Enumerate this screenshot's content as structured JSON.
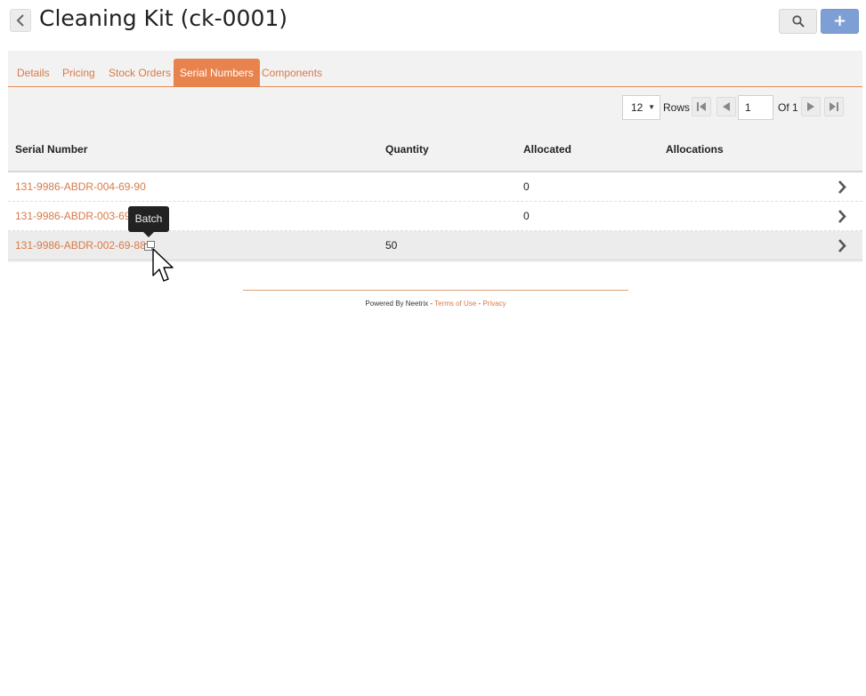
{
  "page": {
    "title": "Cleaning Kit (ck-0001)"
  },
  "header": {
    "back_icon": "chevron-left-icon",
    "search_icon": "search-icon",
    "add_label": "+"
  },
  "tabs": [
    {
      "label": "Details",
      "active": false
    },
    {
      "label": "Pricing",
      "active": false
    },
    {
      "label": "Stock Orders",
      "active": false
    },
    {
      "label": "Serial Numbers",
      "active": true
    },
    {
      "label": "Components",
      "active": false
    }
  ],
  "pager": {
    "rows_per_page": "12",
    "rows_label": "Rows",
    "current_page": "1",
    "of_label": "Of 1"
  },
  "table": {
    "columns": [
      "Serial Number",
      "Quantity",
      "Allocated",
      "Allocations"
    ],
    "rows": [
      {
        "serial": "131-9986-ABDR-004-69-90",
        "quantity": "",
        "allocated": "0",
        "allocations": ""
      },
      {
        "serial": "131-9986-ABDR-003-69-89",
        "quantity": "",
        "allocated": "0",
        "allocations": ""
      },
      {
        "serial": "131-9986-ABDR-002-69-88",
        "quantity": "50",
        "allocated": "",
        "allocations": "",
        "batch": true
      }
    ]
  },
  "tooltip": {
    "text": "Batch"
  },
  "footer": {
    "powered_by": "Powered By Neetrix - ",
    "terms": "Terms of Use",
    "separator": " - ",
    "privacy": "Privacy"
  },
  "colors": {
    "accent": "#e8834d",
    "link": "#d97a47",
    "add_button": "#7e9fd6"
  }
}
